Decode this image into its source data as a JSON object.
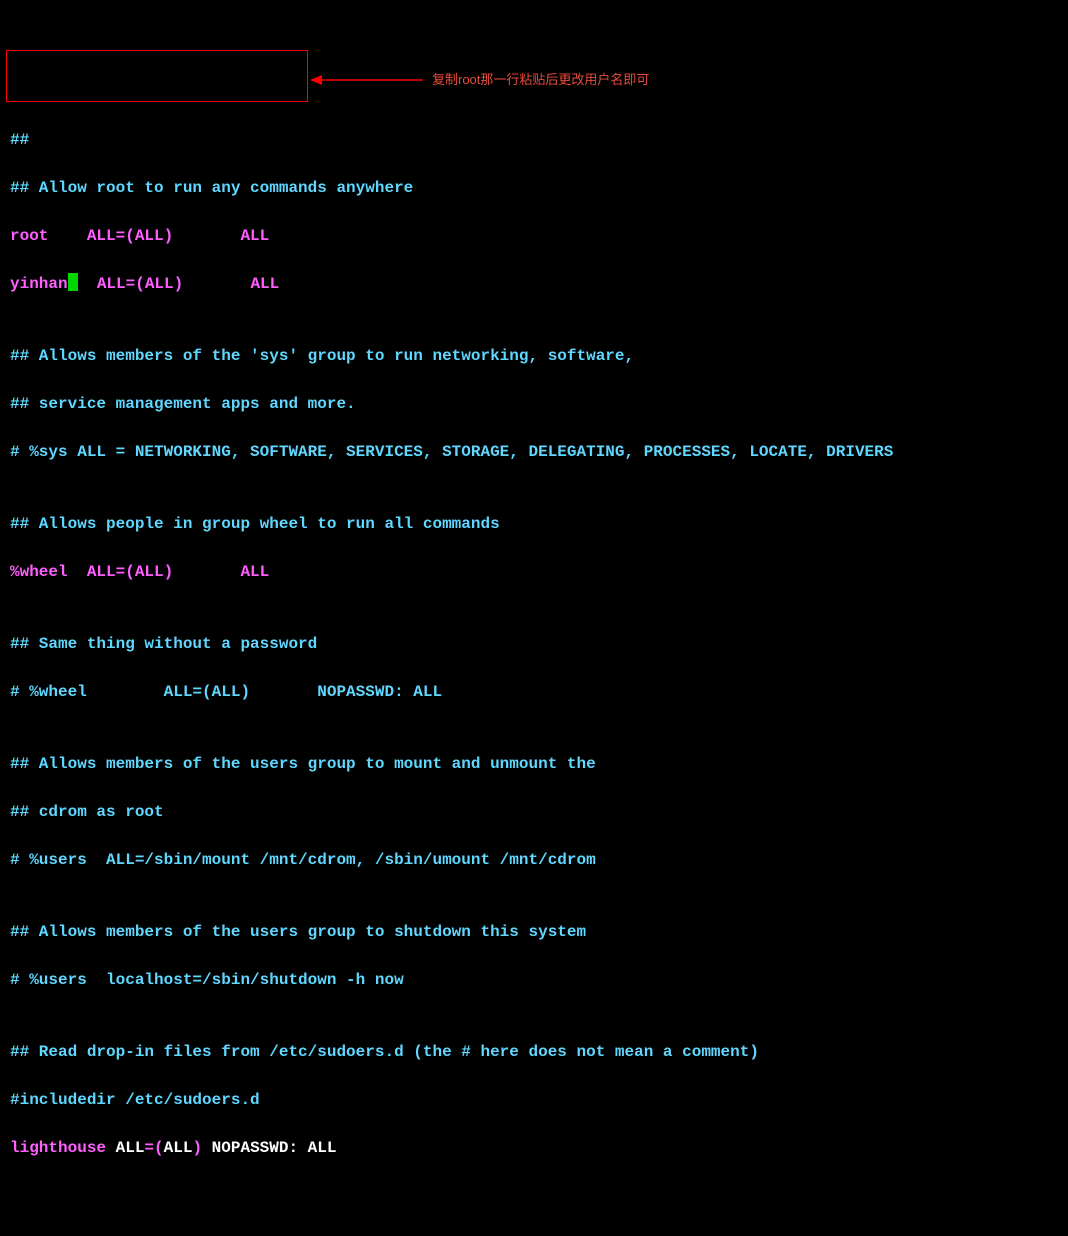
{
  "lines": {
    "l1": "##",
    "l2": "## Allow root to run any commands anywhere",
    "root_user": "root",
    "root_spec": "    ALL=(ALL)       ",
    "root_end": "ALL",
    "yinhan_user": "yinhan",
    "yinhan_spec": "  ALL=(ALL)       ",
    "yinhan_end": "ALL",
    "l5": "",
    "l6": "## Allows members of the 'sys' group to run networking, software,",
    "l7": "## service management apps and more.",
    "l8": "# %sys ALL = NETWORKING, SOFTWARE, SERVICES, STORAGE, DELEGATING, PROCESSES, LOCATE, DRIVERS",
    "l9": "",
    "l10": "## Allows people in group wheel to run all commands",
    "wheel_user": "%wheel",
    "wheel_spec": "  ALL=(ALL)       ",
    "wheel_end": "ALL",
    "l12": "",
    "l13": "## Same thing without a password",
    "l14": "# %wheel        ALL=(ALL)       NOPASSWD: ALL",
    "l15": "",
    "l16": "## Allows members of the users group to mount and unmount the",
    "l17": "## cdrom as root",
    "l18": "# %users  ALL=/sbin/mount /mnt/cdrom, /sbin/umount /mnt/cdrom",
    "l19": "",
    "l20": "## Allows members of the users group to shutdown this system",
    "l21": "# %users  localhost=/sbin/shutdown -h now",
    "l22": "",
    "l23": "## Read drop-in files from /etc/sudoers.d (the # here does not mean a comment)",
    "l24": "#includedir /etc/sudoers.d",
    "lh_user": "lighthouse",
    "lh_spec1": " ALL",
    "lh_eq": "=",
    "lh_paren_o": "(",
    "lh_all2": "ALL",
    "lh_paren_c": ")",
    "lh_rest": " NOPASSWD: ALL"
  },
  "annotation_text": "复制root那一行粘贴后更改用户名即可",
  "colors": {
    "cyan": "#5fd7ff",
    "magenta": "#ff5fff",
    "red": "#ff0000",
    "cursor_green": "#00d700",
    "annotation_red": "#e74c3c"
  }
}
